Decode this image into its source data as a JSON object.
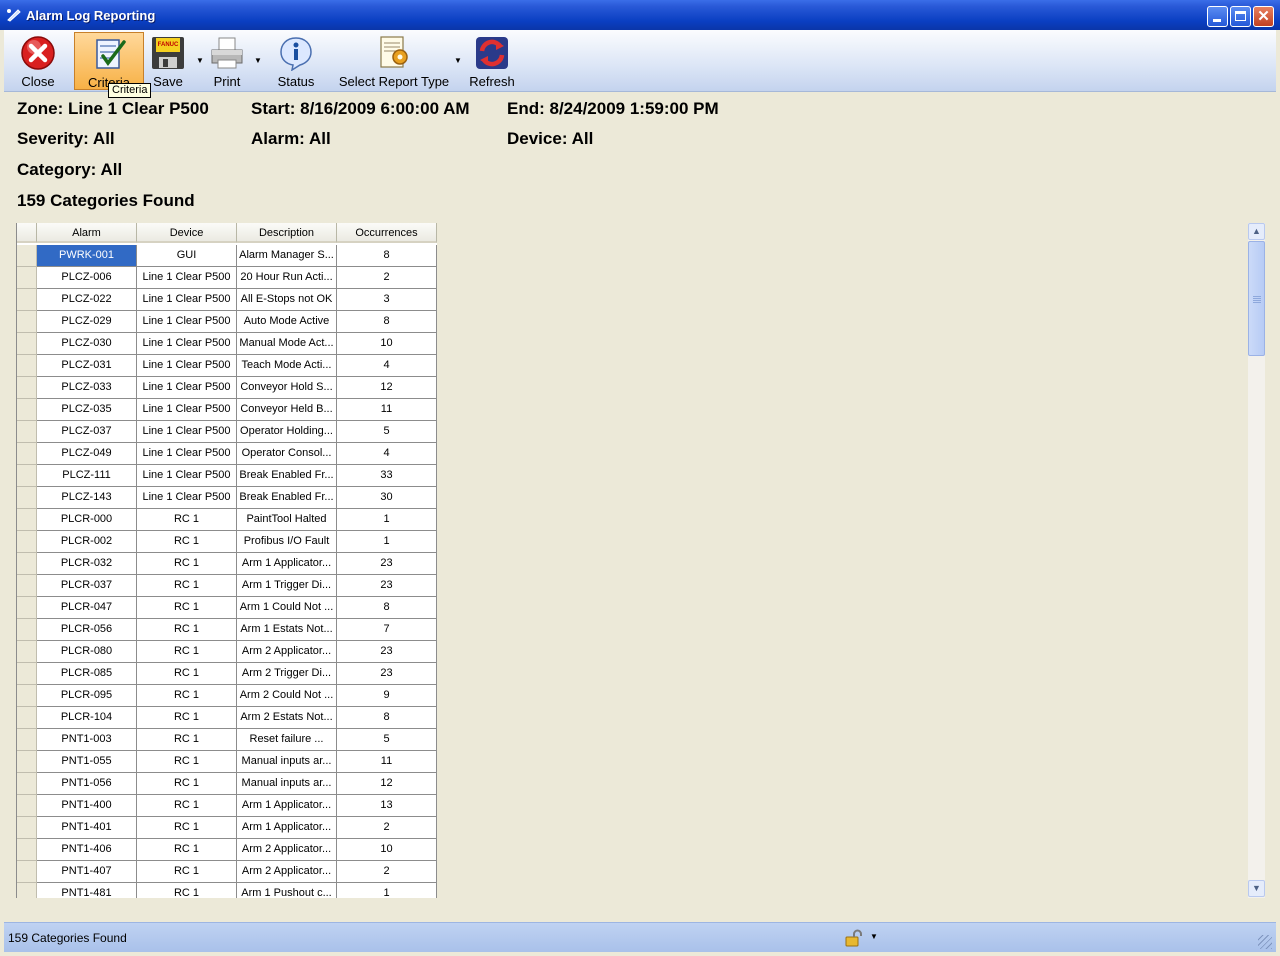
{
  "window": {
    "title": "Alarm Log Reporting"
  },
  "toolbar": {
    "close_label": "Close",
    "criteria_label": "Criteria",
    "save_label": "Save",
    "print_label": "Print",
    "status_label": "Status",
    "report_type_label": "Select Report Type",
    "refresh_label": "Refresh",
    "tooltip": "Criteria",
    "save_icon_text": "FANUC"
  },
  "filters": {
    "zone": "Zone: Line 1 Clear P500",
    "start": "Start: 8/16/2009 6:00:00 AM",
    "end": "End: 8/24/2009 1:59:00 PM",
    "severity": "Severity: All",
    "alarm": "Alarm: All",
    "device": "Device: All",
    "category": "Category: All",
    "found": "159 Categories Found"
  },
  "grid": {
    "columns": [
      "Alarm",
      "Device",
      "Description",
      "Occurrences"
    ],
    "rows": [
      {
        "alarm": "PWRK-001",
        "device": "GUI",
        "description": "Alarm Manager S...",
        "occurrences": "8"
      },
      {
        "alarm": "PLCZ-006",
        "device": "Line 1 Clear P500",
        "description": "20 Hour Run Acti...",
        "occurrences": "2"
      },
      {
        "alarm": "PLCZ-022",
        "device": "Line 1 Clear P500",
        "description": "All E-Stops not OK",
        "occurrences": "3"
      },
      {
        "alarm": "PLCZ-029",
        "device": "Line 1 Clear P500",
        "description": "Auto Mode Active",
        "occurrences": "8"
      },
      {
        "alarm": "PLCZ-030",
        "device": "Line 1 Clear P500",
        "description": "Manual Mode Act...",
        "occurrences": "10"
      },
      {
        "alarm": "PLCZ-031",
        "device": "Line 1 Clear P500",
        "description": "Teach Mode Acti...",
        "occurrences": "4"
      },
      {
        "alarm": "PLCZ-033",
        "device": "Line 1 Clear P500",
        "description": "Conveyor Hold S...",
        "occurrences": "12"
      },
      {
        "alarm": "PLCZ-035",
        "device": "Line 1 Clear P500",
        "description": "Conveyor Held B...",
        "occurrences": "11"
      },
      {
        "alarm": "PLCZ-037",
        "device": "Line 1 Clear P500",
        "description": "Operator Holding...",
        "occurrences": "5"
      },
      {
        "alarm": "PLCZ-049",
        "device": "Line 1 Clear P500",
        "description": "Operator Consol...",
        "occurrences": "4"
      },
      {
        "alarm": "PLCZ-111",
        "device": "Line 1 Clear P500",
        "description": "Break Enabled Fr...",
        "occurrences": "33"
      },
      {
        "alarm": "PLCZ-143",
        "device": "Line 1 Clear P500",
        "description": "Break Enabled Fr...",
        "occurrences": "30"
      },
      {
        "alarm": "PLCR-000",
        "device": "RC 1",
        "description": "PaintTool Halted",
        "occurrences": "1"
      },
      {
        "alarm": "PLCR-002",
        "device": "RC 1",
        "description": "Profibus I/O Fault",
        "occurrences": "1"
      },
      {
        "alarm": "PLCR-032",
        "device": "RC 1",
        "description": "Arm 1 Applicator...",
        "occurrences": "23"
      },
      {
        "alarm": "PLCR-037",
        "device": "RC 1",
        "description": "Arm 1 Trigger Di...",
        "occurrences": "23"
      },
      {
        "alarm": "PLCR-047",
        "device": "RC 1",
        "description": "Arm 1 Could Not ...",
        "occurrences": "8"
      },
      {
        "alarm": "PLCR-056",
        "device": "RC 1",
        "description": "Arm 1 Estats Not...",
        "occurrences": "7"
      },
      {
        "alarm": "PLCR-080",
        "device": "RC 1",
        "description": "Arm 2 Applicator...",
        "occurrences": "23"
      },
      {
        "alarm": "PLCR-085",
        "device": "RC 1",
        "description": "Arm 2 Trigger Di...",
        "occurrences": "23"
      },
      {
        "alarm": "PLCR-095",
        "device": "RC 1",
        "description": "Arm 2 Could Not ...",
        "occurrences": "9"
      },
      {
        "alarm": "PLCR-104",
        "device": "RC 1",
        "description": "Arm 2 Estats Not...",
        "occurrences": "8"
      },
      {
        "alarm": "PNT1-003",
        "device": "RC 1",
        "description": "Reset failure        ...",
        "occurrences": "5"
      },
      {
        "alarm": "PNT1-055",
        "device": "RC 1",
        "description": "Manual inputs ar...",
        "occurrences": "11"
      },
      {
        "alarm": "PNT1-056",
        "device": "RC 1",
        "description": "Manual inputs ar...",
        "occurrences": "12"
      },
      {
        "alarm": "PNT1-400",
        "device": "RC 1",
        "description": "Arm 1 Applicator...",
        "occurrences": "13"
      },
      {
        "alarm": "PNT1-401",
        "device": "RC 1",
        "description": "Arm 1 Applicator...",
        "occurrences": "2"
      },
      {
        "alarm": "PNT1-406",
        "device": "RC 1",
        "description": "Arm 2 Applicator...",
        "occurrences": "10"
      },
      {
        "alarm": "PNT1-407",
        "device": "RC 1",
        "description": "Arm 2 Applicator...",
        "occurrences": "2"
      },
      {
        "alarm": "PNT1-481",
        "device": "RC 1",
        "description": "Arm 1 Pushout c...",
        "occurrences": "1"
      }
    ]
  },
  "status_bar": {
    "text": "159 Categories Found"
  },
  "colors": {
    "selection": "#316ac5",
    "title_bar": "#0a3fc2",
    "face": "#ece9d8"
  }
}
